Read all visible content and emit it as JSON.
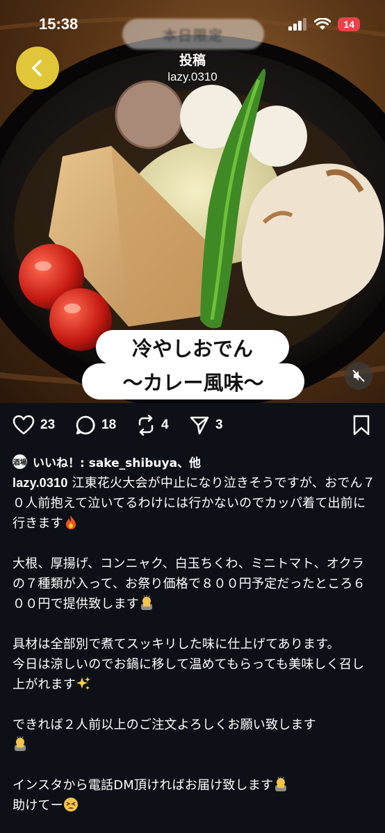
{
  "status_bar": {
    "time": "15:38",
    "battery": "14"
  },
  "promo_pill": "本日限定",
  "header": {
    "title": "投稿",
    "username": "lazy.0310"
  },
  "caption": {
    "line1": "冷やしおでん",
    "line2": "〜カレー風味〜"
  },
  "actions": {
    "likes": "23",
    "comments": "18",
    "reposts": "4",
    "shares": "3"
  },
  "liked_by": {
    "badge": "酒場",
    "text": "いいね！: sake_shibuya、他"
  },
  "post": {
    "username": "lazy.0310",
    "p1": " 江東花火大会が中止になり泣きそうですが、おでん７０人前抱えて泣いてるわけには行かないのでカッパ着て出前に行きます",
    "p2": "大根、厚揚げ、コンニャク、白玉ちくわ、ミニトマト、オクラの７種類が入って、お祭り価格で８００円予定だったところ６００円で提供致します",
    "p3": "具材は全部別で煮てスッキリした味に仕上げてあります。\n今日は涼しいのでお鍋に移して温めてもらっても美味しく召し上がれます",
    "p4": "できれば２人前以上のご注文よろしくお願い致します",
    "p5": "インスタから電話DM頂ければお届け致します",
    "p6": "助けてー"
  },
  "icons": [
    "back-icon",
    "heart-icon",
    "comment-icon",
    "repost-icon",
    "share-icon",
    "bookmark-icon",
    "mute-icon",
    "fire-emoji",
    "bowing-emoji",
    "sparkles-emoji",
    "tired-emoji"
  ]
}
